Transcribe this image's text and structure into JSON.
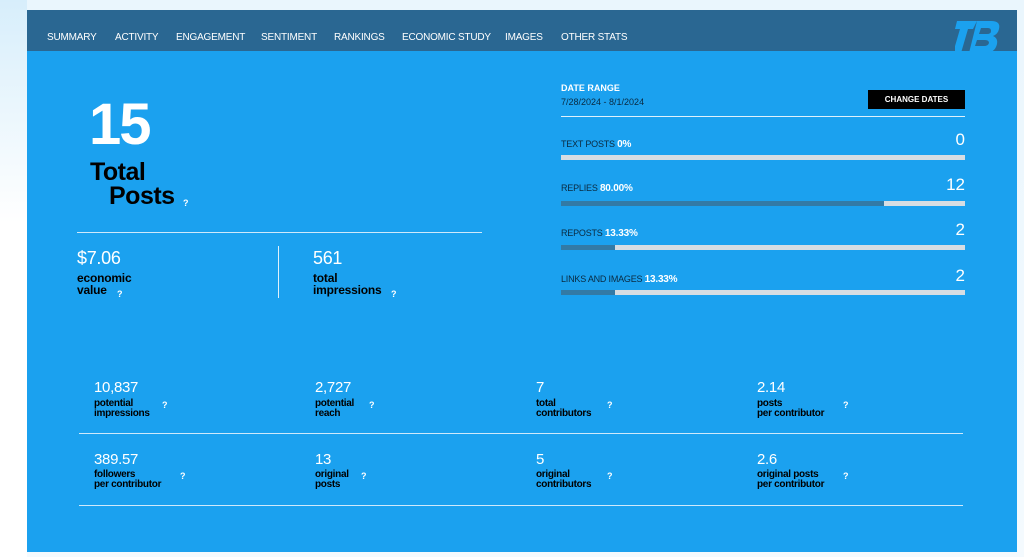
{
  "nav": {
    "items": [
      "SUMMARY",
      "ACTIVITY",
      "ENGAGEMENT",
      "SENTIMENT",
      "RANKINGS",
      "ECONOMIC STUDY",
      "IMAGES",
      "OTHER STATS"
    ]
  },
  "logo": {
    "icon": "tb-logo"
  },
  "summary": {
    "total_posts_value": "15",
    "total_label_line1": "Total",
    "total_label_line2": "Posts",
    "help": "?"
  },
  "economic_value": {
    "value": "$7.06",
    "label_line1": "economic",
    "label_line2": "value",
    "help": "?"
  },
  "total_impressions": {
    "value": "561",
    "label_line1": "total",
    "label_line2": "impressions",
    "help": "?"
  },
  "date_range": {
    "title": "DATE RANGE",
    "range": "7/28/2024 - 8/1/2024",
    "button_label": "CHANGE DATES"
  },
  "metrics": [
    {
      "label": "TEXT POSTS",
      "percent": "0%",
      "count": "0",
      "share": 0.0
    },
    {
      "label": "REPLIES",
      "percent": "80.00%",
      "count": "12",
      "share": 0.8
    },
    {
      "label": "REPOSTS",
      "percent": "13.33%",
      "count": "2",
      "share": 0.1333
    },
    {
      "label": "LINKS AND IMAGES",
      "percent": "13.33%",
      "count": "2",
      "share": 0.1333
    }
  ],
  "grid": [
    {
      "value": "10,837",
      "l1": "potential",
      "l2": "impressions",
      "help": "?"
    },
    {
      "value": "2,727",
      "l1": "potential",
      "l2": "reach",
      "help": "?"
    },
    {
      "value": "7",
      "l1": "total",
      "l2": "contributors",
      "help": "?"
    },
    {
      "value": "2.14",
      "l1": "posts",
      "l2": "per contributor",
      "help": "?"
    },
    {
      "value": "389.57",
      "l1": "followers",
      "l2": "per contributor",
      "help": "?"
    },
    {
      "value": "13",
      "l1": "original",
      "l2": "posts",
      "help": "?"
    },
    {
      "value": "5",
      "l1": "original",
      "l2": "contributors",
      "help": "?"
    },
    {
      "value": "2.6",
      "l1": "original posts",
      "l2": "per contributor",
      "help": "?"
    }
  ],
  "colors": {
    "panel": "#1ba1ef",
    "nav": "#2a6792",
    "bar_track": "#d6dde3",
    "bar_fill": "#327aa6"
  }
}
